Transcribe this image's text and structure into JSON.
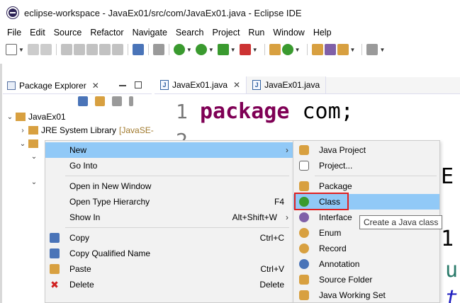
{
  "window": {
    "title": "eclipse-workspace - JavaEx01/src/com/JavaEx01.java - Eclipse IDE"
  },
  "menubar": [
    "File",
    "Edit",
    "Source",
    "Refactor",
    "Navigate",
    "Search",
    "Project",
    "Run",
    "Window",
    "Help"
  ],
  "package_explorer": {
    "title": "Package Explorer",
    "tree": [
      {
        "label": "JavaEx01",
        "decoration": ""
      },
      {
        "label": "JRE System Library",
        "decoration": "[JavaSE-"
      }
    ]
  },
  "editor": {
    "tabs": [
      {
        "label": "JavaEx01.java",
        "active": true
      },
      {
        "label": "JavaEx01.java",
        "active": false
      }
    ],
    "line_numbers": [
      "1",
      "2"
    ],
    "code_line_1": {
      "keyword": "package",
      "rest": " com;"
    },
    "peek": [
      "E",
      "1",
      "u",
      "t"
    ]
  },
  "context_menu": {
    "items": [
      {
        "label": "New",
        "shortcut": "",
        "submenu": true,
        "highlighted": true,
        "icon": ""
      },
      {
        "label": "Go Into",
        "shortcut": "",
        "submenu": false,
        "icon": ""
      },
      {
        "label": "Open in New Window",
        "shortcut": "",
        "submenu": false,
        "icon": ""
      },
      {
        "label": "Open Type Hierarchy",
        "shortcut": "F4",
        "submenu": false,
        "icon": ""
      },
      {
        "label": "Show In",
        "shortcut": "Alt+Shift+W",
        "submenu": true,
        "icon": ""
      },
      {
        "label": "Copy",
        "shortcut": "Ctrl+C",
        "submenu": false,
        "icon": "copy-icon"
      },
      {
        "label": "Copy Qualified Name",
        "shortcut": "",
        "submenu": false,
        "icon": "copy-qualified-icon"
      },
      {
        "label": "Paste",
        "shortcut": "Ctrl+V",
        "submenu": false,
        "icon": "paste-icon"
      },
      {
        "label": "Delete",
        "shortcut": "Delete",
        "submenu": false,
        "icon": "delete-icon"
      }
    ]
  },
  "submenu_new": {
    "items": [
      {
        "label": "Java Project",
        "icon": "java-project-icon"
      },
      {
        "label": "Project...",
        "icon": "project-icon"
      },
      {
        "label": "Package",
        "icon": "package-icon"
      },
      {
        "label": "Class",
        "icon": "class-icon",
        "highlighted": true
      },
      {
        "label": "Interface",
        "icon": "interface-icon"
      },
      {
        "label": "Enum",
        "icon": "enum-icon"
      },
      {
        "label": "Record",
        "icon": "record-icon"
      },
      {
        "label": "Annotation",
        "icon": "annotation-icon"
      },
      {
        "label": "Source Folder",
        "icon": "source-folder-icon"
      },
      {
        "label": "Java Working Set",
        "icon": "working-set-icon"
      }
    ]
  },
  "tooltip": "Create a Java class",
  "colors": {
    "highlight": "#91c9f7",
    "keyword": "#7f0055",
    "callout": "#e02020"
  }
}
